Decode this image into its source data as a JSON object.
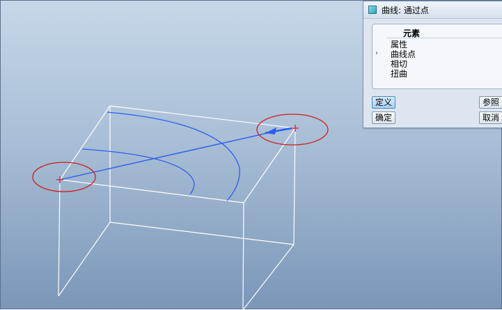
{
  "dialog": {
    "title": "曲线: 通过点",
    "header": "元素",
    "items": [
      "属性",
      "曲线点",
      "相切",
      "扭曲"
    ],
    "current_item_marker": "›",
    "buttons": {
      "define": "定义",
      "references": "参照",
      "ok": "确定",
      "cancel": "取消"
    }
  },
  "colors": {
    "background_top": "#c6d7e8",
    "background_bottom": "#7b96b8",
    "wireframe": "#ffffff",
    "curve": "#2d5cf0",
    "highlight_ring": "#d11a1a",
    "point": "#d11a1a"
  }
}
